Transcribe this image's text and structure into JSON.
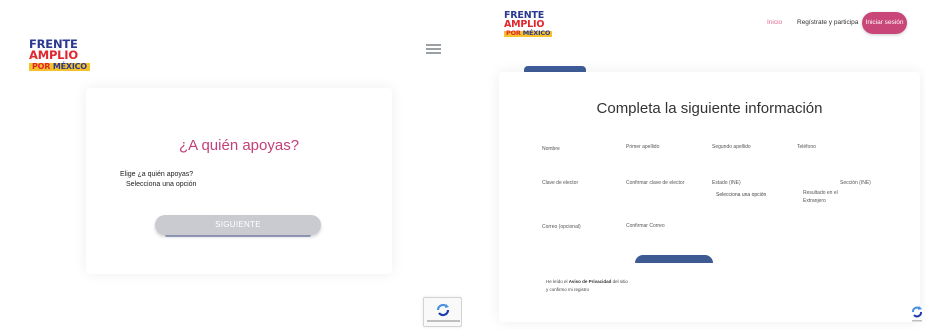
{
  "brand": {
    "line1": "FRENTE",
    "line2": "AMPLIO",
    "line3_a": "POR",
    "line3_b": "MÉXICO"
  },
  "left": {
    "card": {
      "title": "¿A quién apoyas?",
      "prompt": "Elige ¿a quién apoyas?",
      "select_value": "Selecciona una opción",
      "next_button": "SIGUIENTE"
    }
  },
  "right": {
    "nav": {
      "home": "Inicio",
      "register": "Regístrate y participa",
      "login": "Iniciar sesión"
    },
    "form": {
      "title": "Completa la siguiente información",
      "fields": {
        "name": "Nombre",
        "first_surname": "Primer apellido",
        "second_surname": "Segundo apellido",
        "phone": "Teléfono",
        "voter_key": "Clave de elector",
        "confirm_voter_key": "Confirmar clave de elector",
        "state": "Estado (INE)",
        "state_value": "Selecciona una opción",
        "municipality_line1": "Resultado en el",
        "municipality_line2": "Extranjero",
        "section": "Sección (INE)",
        "email": "Correo (opcional)",
        "confirm_email": "Confirmar Correo"
      },
      "privacy": {
        "prefix": "He leído el",
        "link": "Aviso de Privacidad",
        "suffix": "del sitio",
        "line2": "y confirmo mi registro"
      }
    }
  },
  "colors": {
    "brand_blue": "#2b3990",
    "brand_red": "#e0262e",
    "brand_yellow": "#f6c22b",
    "accent_pink": "#c94778",
    "title_pink": "#c2407a",
    "button_gray": "#c9cbd0"
  },
  "icons": {
    "menu": "hamburger-icon",
    "captcha": "recaptcha-icon"
  }
}
